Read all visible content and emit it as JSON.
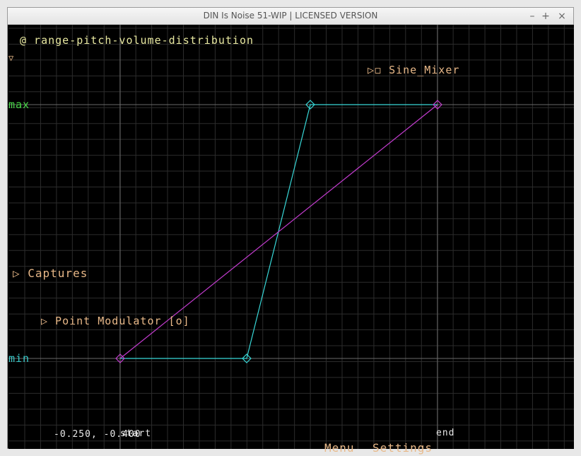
{
  "window": {
    "title": "DIN Is Noise 51-WIP | LICENSED VERSION",
    "minimize_glyph": "–",
    "maximize_glyph": "+",
    "close_glyph": "×"
  },
  "editor": {
    "name": "@ range-pitch-volume-distribution",
    "collapse_glyph": "▽",
    "sine_mixer": "▷◻ Sine_Mixer",
    "captures": "▷ Captures",
    "point_modulator": "▷ Point Modulator [o]",
    "max_label": "max",
    "min_label": "min",
    "start_label": "start",
    "end_label": "end",
    "coords": "-0.250, -0.400"
  },
  "menu": {
    "menu_label": "Menu",
    "settings_label": "Settings"
  },
  "colors": {
    "grid": "#2c2c2c",
    "axis": "#6a6a6a",
    "curve_cyan": "#38d8d8",
    "curve_magenta": "#c43cd0",
    "orange": "#e8b888",
    "yellow": "#e8e8a0",
    "green": "#48d848",
    "cyan_label": "#38c8c8"
  }
}
